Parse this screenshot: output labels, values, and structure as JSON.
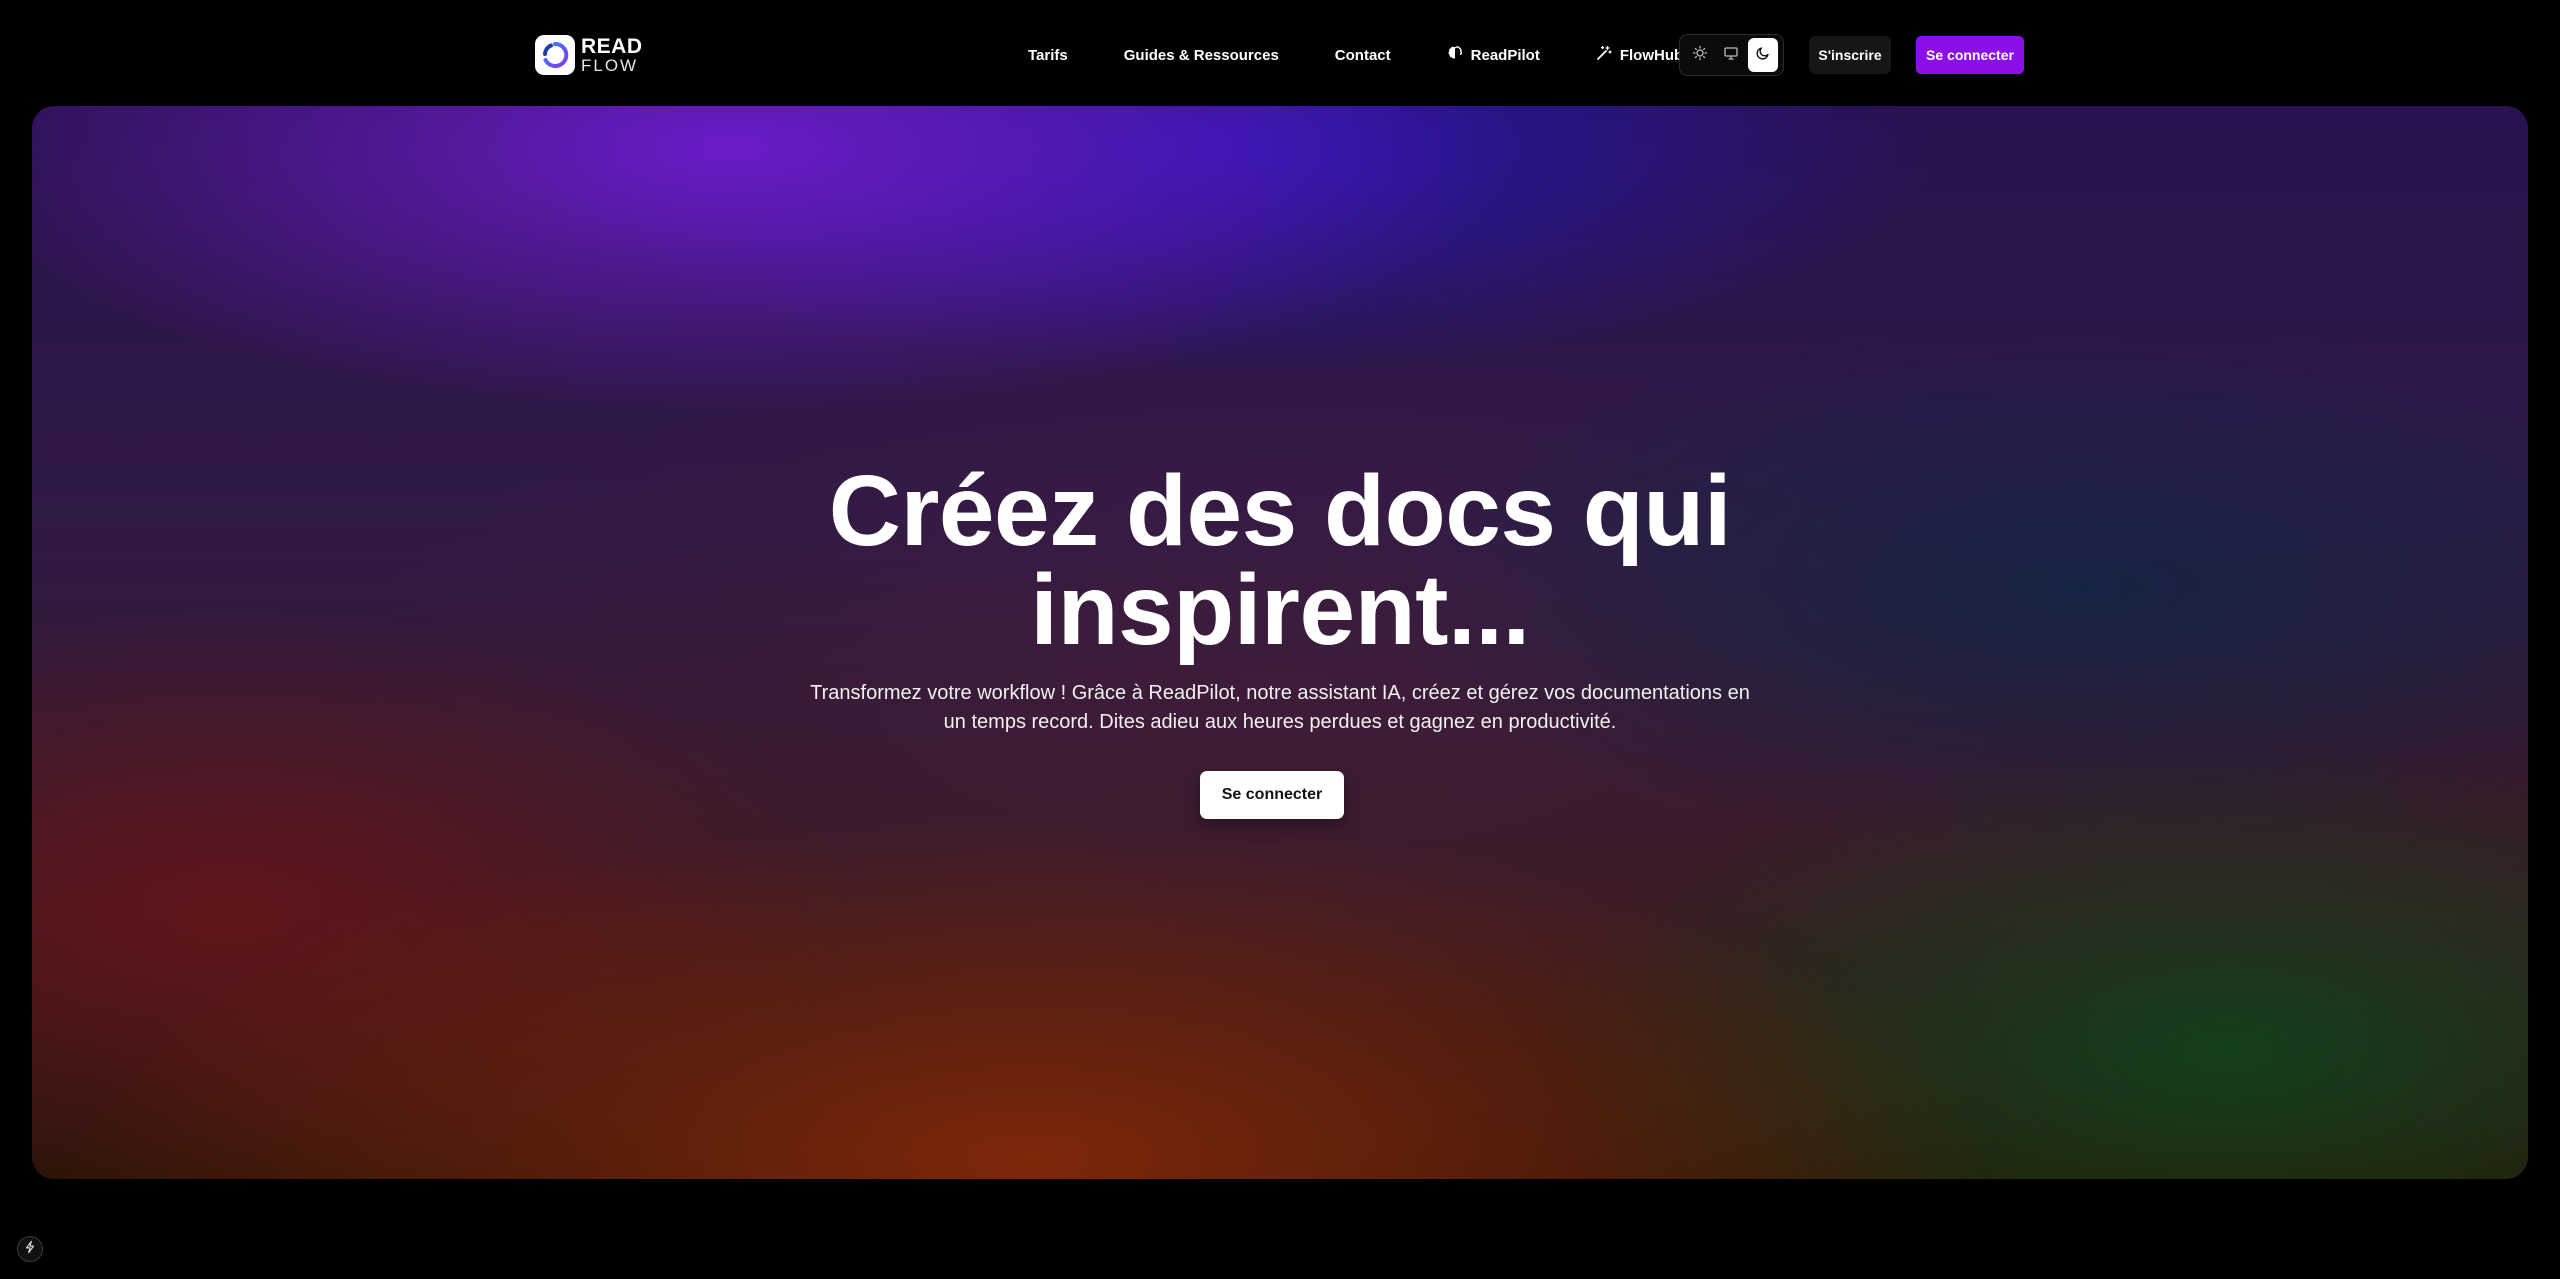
{
  "brand": {
    "line1": "READ",
    "line2": "FLOW",
    "logo_icon": "readflow-logo"
  },
  "nav": {
    "items": [
      {
        "label": "Tarifs",
        "icon": null
      },
      {
        "label": "Guides & Ressources",
        "icon": null
      },
      {
        "label": "Contact",
        "icon": null
      },
      {
        "label": "ReadPilot",
        "icon": "brain-icon"
      },
      {
        "label": "FlowHub",
        "icon": "magic-wand-icon"
      }
    ]
  },
  "theme_switch": {
    "options": [
      "light",
      "system",
      "dark"
    ],
    "selected": "dark"
  },
  "auth": {
    "signup_label": "S'inscrire",
    "login_label": "Se connecter"
  },
  "hero": {
    "title_line1": "Créez des docs qui",
    "title_line2": "inspirent...",
    "subtitle": "Transformez votre workflow ! Grâce à ReadPilot, notre assistant IA, créez et gérez vos documentations en un temps record. Dites adieu aux heures perdues et gagnez en productivité.",
    "cta_label": "Se connecter"
  },
  "colors": {
    "accent": "#8b0fe8",
    "background": "#000000"
  }
}
